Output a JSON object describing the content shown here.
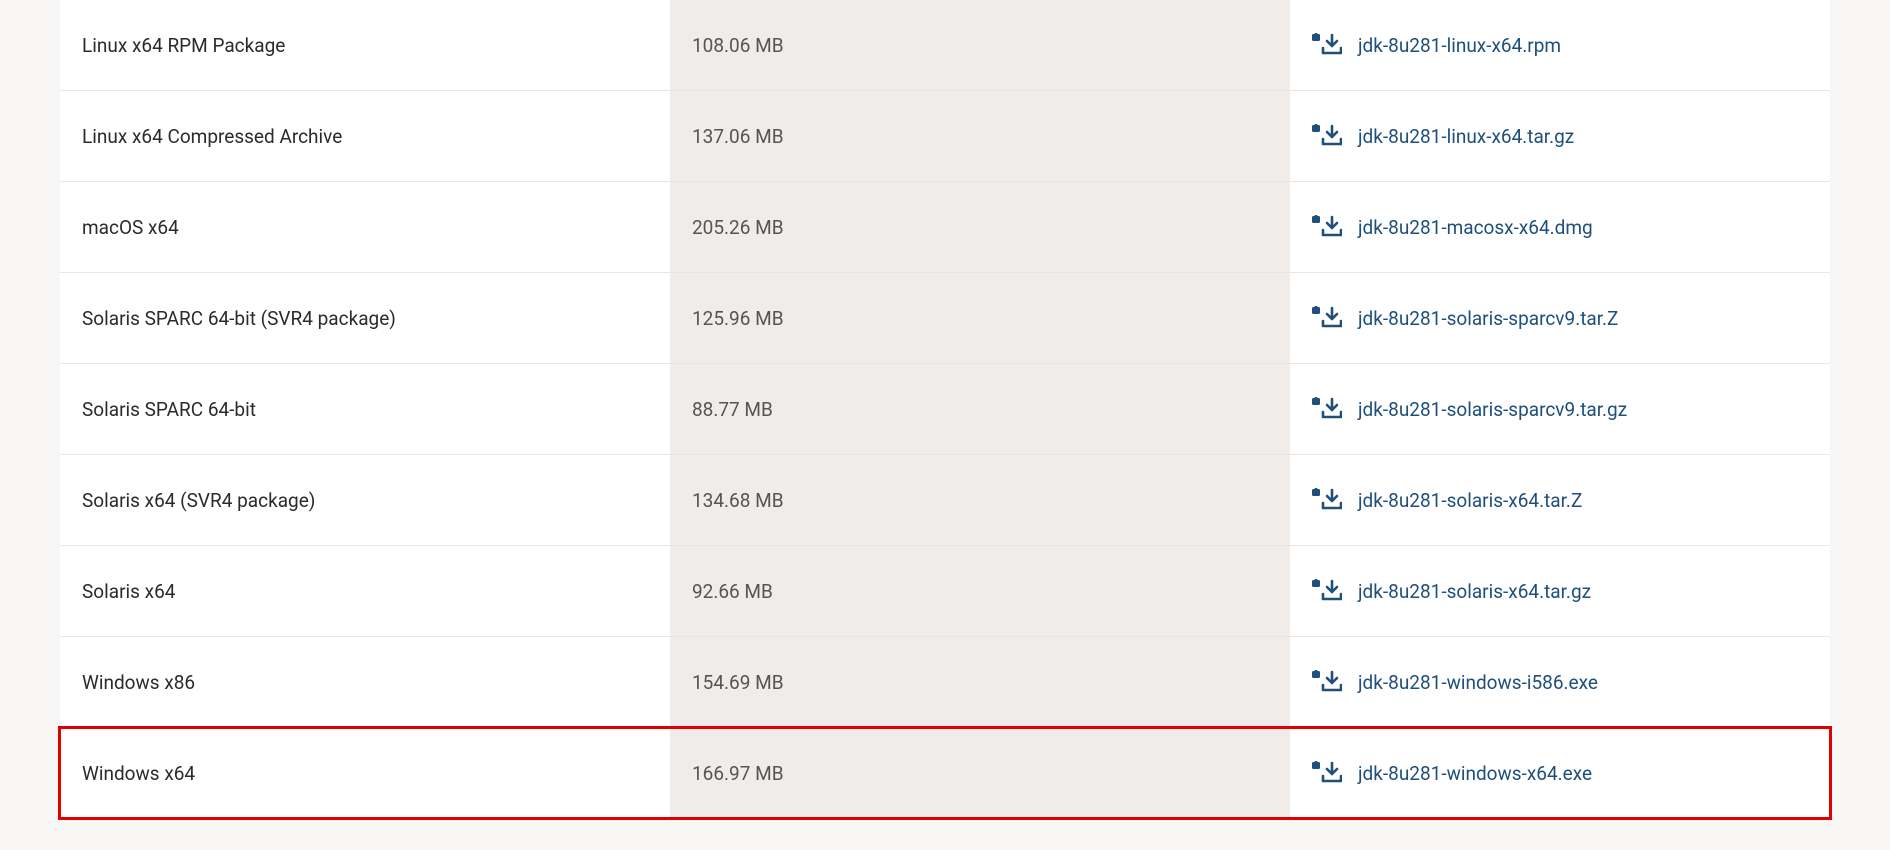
{
  "link_color": "#1f4f7a",
  "rows": [
    {
      "product": "Linux x64 RPM Package",
      "size": "108.06 MB",
      "file": "jdk-8u281-linux-x64.rpm",
      "highlighted": false
    },
    {
      "product": "Linux x64 Compressed Archive",
      "size": "137.06 MB",
      "file": "jdk-8u281-linux-x64.tar.gz",
      "highlighted": false
    },
    {
      "product": "macOS x64",
      "size": "205.26 MB",
      "file": "jdk-8u281-macosx-x64.dmg",
      "highlighted": false
    },
    {
      "product": "Solaris SPARC 64-bit (SVR4 package)",
      "size": "125.96 MB",
      "file": "jdk-8u281-solaris-sparcv9.tar.Z",
      "highlighted": false
    },
    {
      "product": "Solaris SPARC 64-bit",
      "size": "88.77 MB",
      "file": "jdk-8u281-solaris-sparcv9.tar.gz",
      "highlighted": false
    },
    {
      "product": "Solaris x64 (SVR4 package)",
      "size": "134.68 MB",
      "file": "jdk-8u281-solaris-x64.tar.Z",
      "highlighted": false
    },
    {
      "product": "Solaris x64",
      "size": "92.66 MB",
      "file": "jdk-8u281-solaris-x64.tar.gz",
      "highlighted": false
    },
    {
      "product": "Windows x86",
      "size": "154.69 MB",
      "file": "jdk-8u281-windows-i586.exe",
      "highlighted": false
    },
    {
      "product": "Windows x64",
      "size": "166.97 MB",
      "file": "jdk-8u281-windows-x64.exe",
      "highlighted": true
    }
  ]
}
